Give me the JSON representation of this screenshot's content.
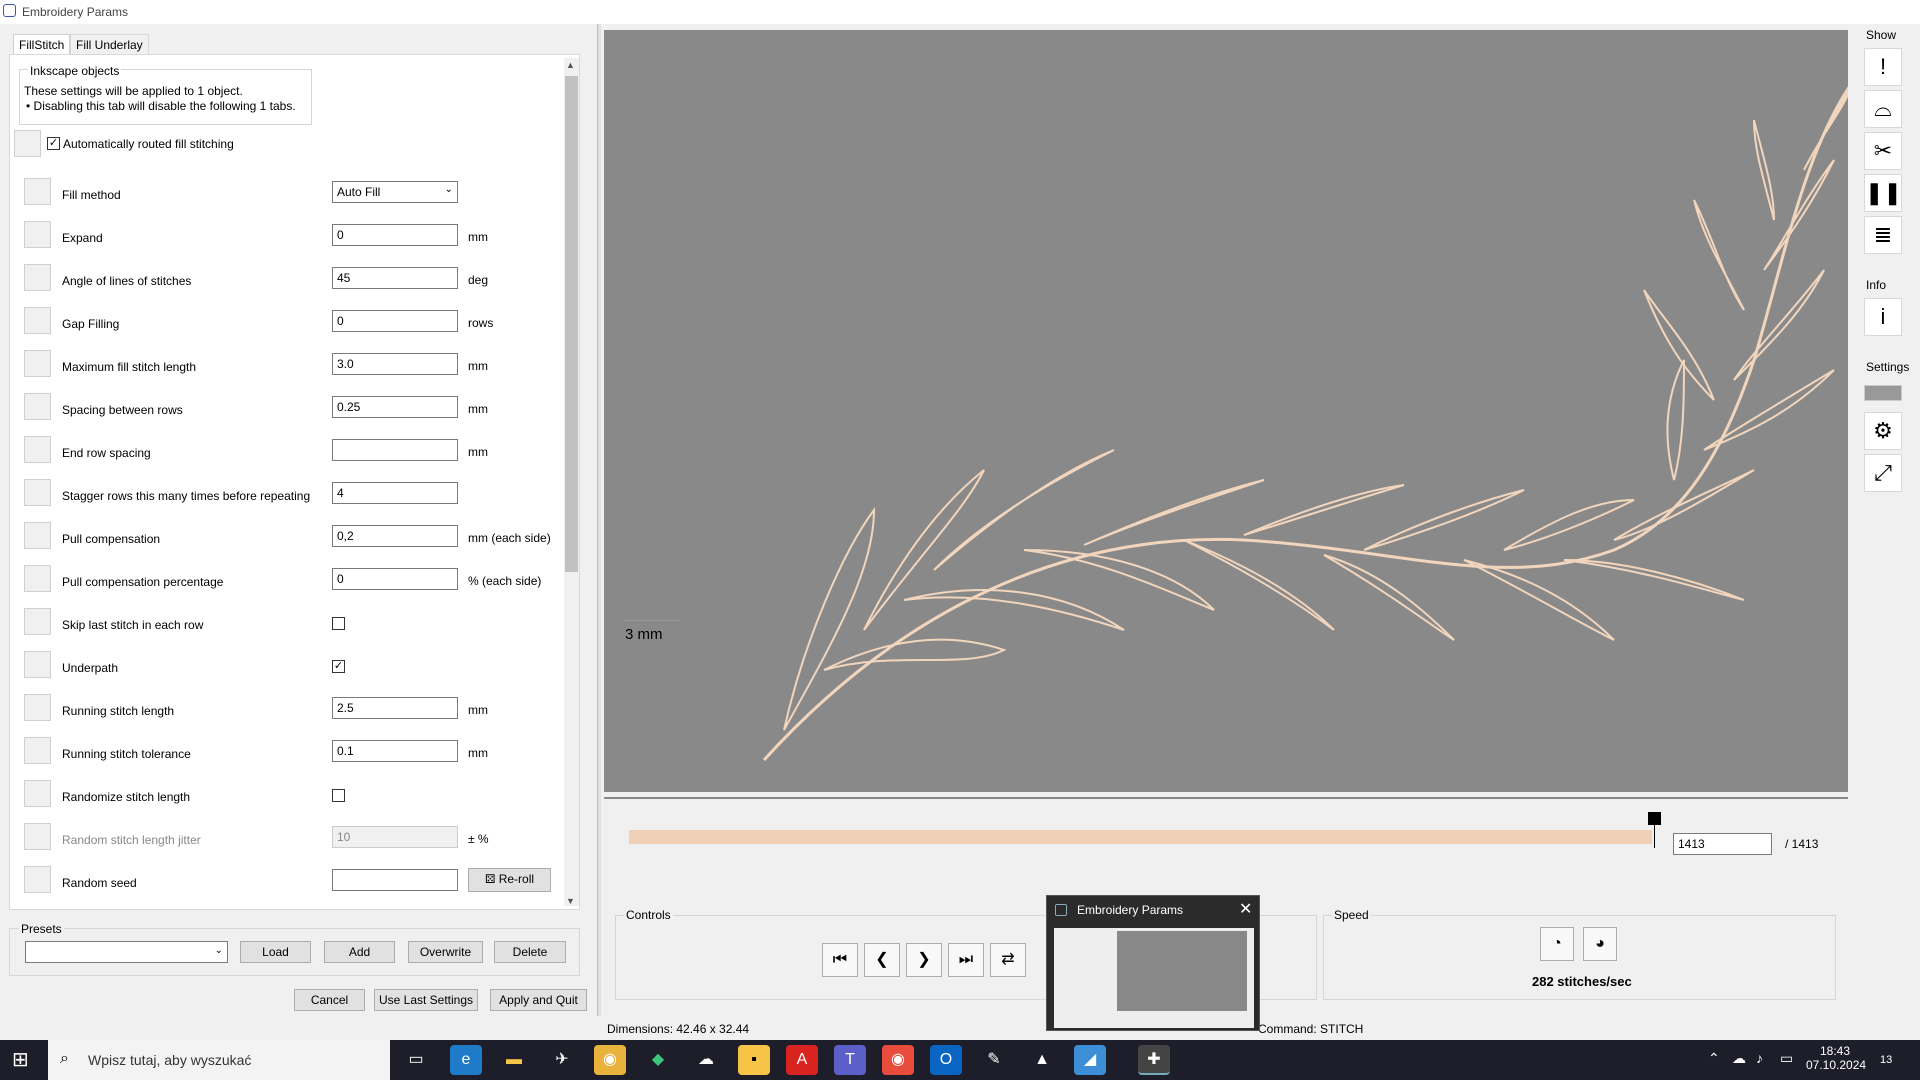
{
  "window": {
    "title": "Embroidery Params"
  },
  "tabs": [
    {
      "label": "FillStitch"
    },
    {
      "label": "Fill Underlay"
    }
  ],
  "info_box": {
    "legend": "Inkscape objects",
    "line1": "These settings will be applied to 1 object.",
    "line2": "• Disabling this tab will disable the following 1 tabs."
  },
  "auto_route": {
    "label": "Automatically routed fill stitching",
    "checked": true
  },
  "params": [
    {
      "label": "Fill method",
      "type": "select",
      "value": "Auto Fill",
      "unit": ""
    },
    {
      "label": "Expand",
      "type": "text",
      "value": "0",
      "unit": "mm"
    },
    {
      "label": "Angle of lines of stitches",
      "type": "text",
      "value": "45",
      "unit": "deg"
    },
    {
      "label": "Gap Filling",
      "type": "text",
      "value": "0",
      "unit": "rows"
    },
    {
      "label": "Maximum fill stitch length",
      "type": "text",
      "value": "3.0",
      "unit": "mm"
    },
    {
      "label": "Spacing between rows",
      "type": "text",
      "value": "0.25",
      "unit": "mm"
    },
    {
      "label": "End row spacing",
      "type": "text",
      "value": "",
      "unit": "mm"
    },
    {
      "label": "Stagger rows this many times before repeating",
      "type": "text",
      "value": "4",
      "unit": ""
    },
    {
      "label": "Pull compensation",
      "type": "text",
      "value": "0,2",
      "unit": "mm (each side)"
    },
    {
      "label": "Pull compensation percentage",
      "type": "text",
      "value": "0",
      "unit": "% (each side)"
    },
    {
      "label": "Skip last stitch in each row",
      "type": "checkbox",
      "checked": false
    },
    {
      "label": "Underpath",
      "type": "checkbox",
      "checked": true
    },
    {
      "label": "Running stitch length",
      "type": "text",
      "value": "2.5",
      "unit": "mm"
    },
    {
      "label": "Running stitch tolerance",
      "type": "text",
      "value": "0.1",
      "unit": "mm"
    },
    {
      "label": "Randomize stitch length",
      "type": "checkbox",
      "checked": false
    },
    {
      "label": "Random stitch length jitter",
      "type": "text",
      "value": "10",
      "unit": "± %",
      "disabled": true
    },
    {
      "label": "Random seed",
      "type": "text",
      "value": "",
      "unit": "",
      "button": "Re-roll"
    }
  ],
  "presets": {
    "legend": "Presets",
    "load": "Load",
    "add": "Add",
    "overwrite": "Overwrite",
    "delete": "Delete"
  },
  "footer": {
    "cancel": "Cancel",
    "use_last": "Use Last Settings",
    "apply": "Apply and Quit"
  },
  "canvas": {
    "scale_label": "3 mm",
    "bg": "#898989",
    "stitch_color": "#f1d5bd"
  },
  "slider": {
    "current": "1413",
    "total": "/ 1413",
    "progress": 1.0
  },
  "controls": {
    "legend": "Controls"
  },
  "speed": {
    "legend": "Speed",
    "value": "282 stitches/sec"
  },
  "right_panel": {
    "show": "Show",
    "info": "Info",
    "settings": "Settings"
  },
  "status": {
    "dimensions": "Dimensions: 42.46 x 32.44",
    "command": "Command: STITCH"
  },
  "popup": {
    "title": "Embroidery Params"
  },
  "taskbar": {
    "search_placeholder": "Wpisz tutaj, aby wyszukać",
    "time": "18:43",
    "date": "07.10.2024",
    "notifications": "13"
  }
}
